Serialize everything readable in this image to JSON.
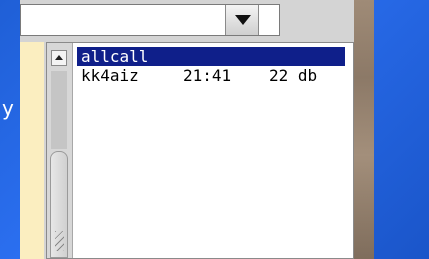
{
  "desktop": {
    "glyph": "y"
  },
  "combo": {
    "value": "",
    "button_icon": "chevron-down-icon"
  },
  "scrollbar": {
    "up_icon": "arrow-up-icon"
  },
  "station_list": {
    "selected_index": 0,
    "rows": [
      {
        "call": "allcall",
        "time": "",
        "snr": ""
      },
      {
        "call": "kk4aiz",
        "time": "21:41",
        "snr": "22 db"
      }
    ]
  },
  "colors": {
    "desktop": "#1f5fd6",
    "selection": "#0f1f8a",
    "left_panel": "#fbeec0"
  }
}
